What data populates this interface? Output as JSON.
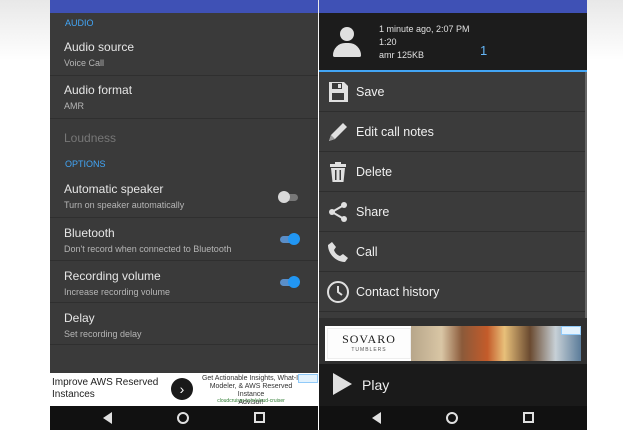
{
  "settings": {
    "sections": {
      "audio": "AUDIO",
      "options": "OPTIONS"
    },
    "audio_source": {
      "title": "Audio source",
      "summary": "Voice Call"
    },
    "audio_format": {
      "title": "Audio format",
      "summary": "AMR"
    },
    "loudness": {
      "title": "Loudness"
    },
    "automatic_speaker": {
      "title": "Automatic speaker",
      "summary": "Turn on speaker automatically",
      "enabled": false
    },
    "bluetooth": {
      "title": "Bluetooth",
      "summary": "Don't record when connected to Bluetooth",
      "enabled": true
    },
    "recording_volume": {
      "title": "Recording volume",
      "summary": "Increase recording volume",
      "enabled": true
    },
    "delay": {
      "title": "Delay",
      "summary": "Set recording delay"
    }
  },
  "left_ad": {
    "headline_line1": "Improve AWS Reserved",
    "headline_line2": "Instances",
    "cta_icon": "chevron-right-icon",
    "body_line1": "Get Actionable Insights, What-If",
    "body_line2": "Modeler, & AWS Reserved Instance",
    "body_line3": "Advisor!",
    "url": "cloudcruiser.com/cloud-cruiser"
  },
  "recording": {
    "time_ago": "1 minute ago, 2:07 PM",
    "duration": "1:20",
    "format_size": "amr 125KB",
    "count": "1"
  },
  "menu": {
    "save": "Save",
    "edit_notes": "Edit call notes",
    "delete": "Delete",
    "share": "Share",
    "call": "Call",
    "history": "Contact history"
  },
  "right_ad": {
    "brand": "SOVARO",
    "brand_sub": "TUMBLERS"
  },
  "player": {
    "play_label": "Play"
  },
  "colors": {
    "accent": "#42a5f5",
    "toggle_on": "#2196f3",
    "app_bar": "#3f51b5"
  }
}
